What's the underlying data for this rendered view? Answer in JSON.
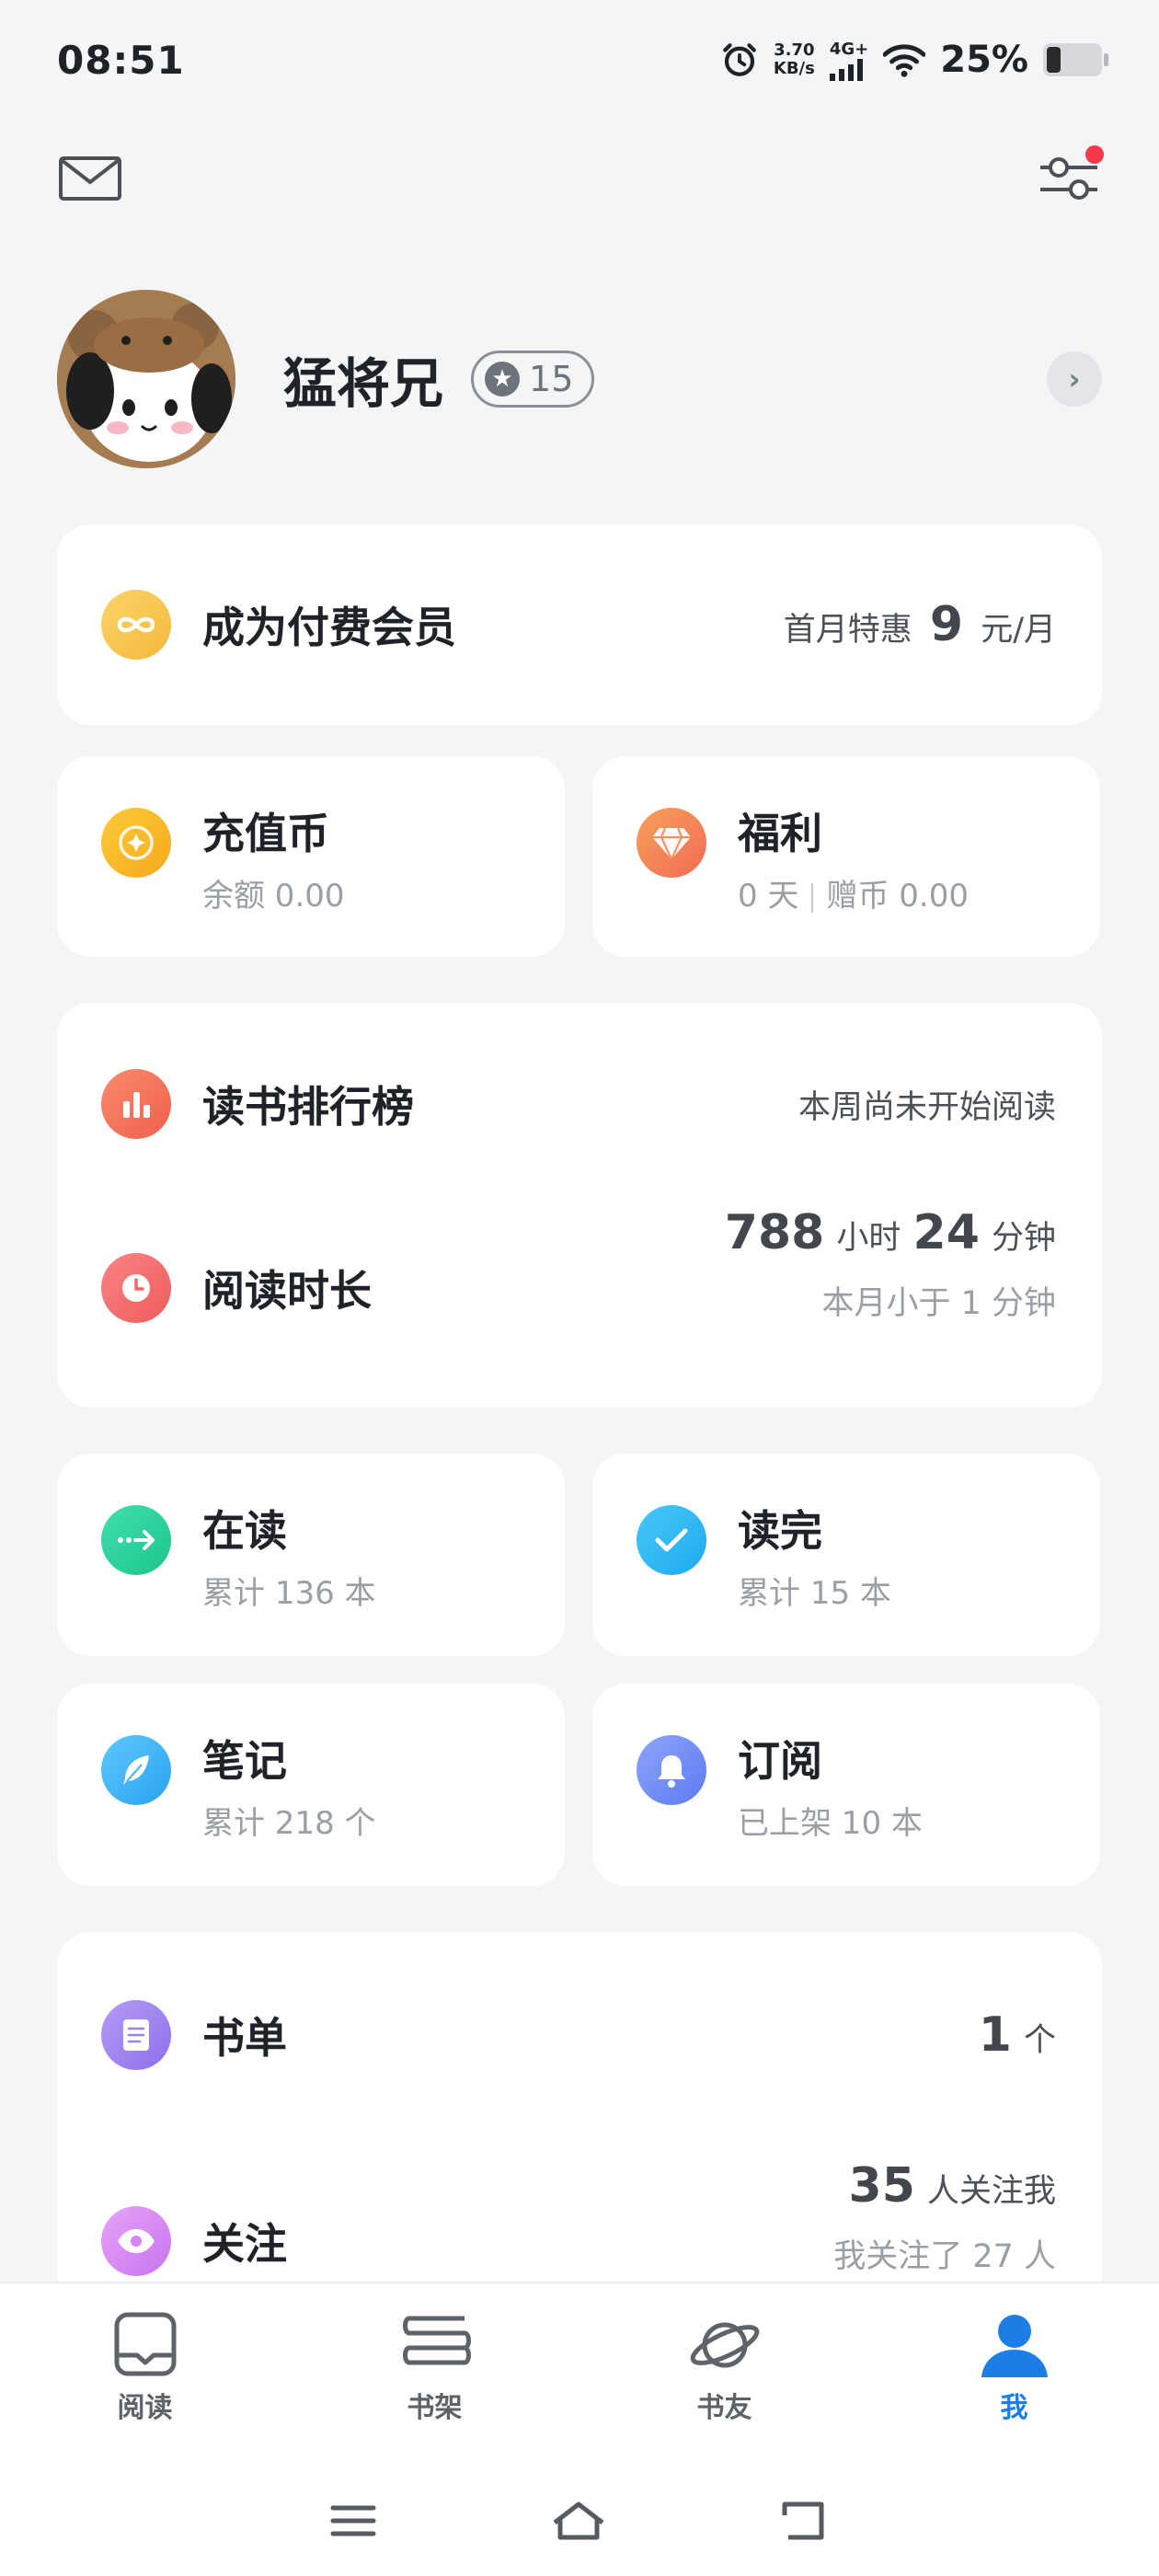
{
  "status_bar": {
    "time": "08:51",
    "speed_value": "3.70",
    "speed_unit": "KB/s",
    "network": "4G+",
    "battery": "25%"
  },
  "profile": {
    "name": "猛将兄",
    "level": "15"
  },
  "membership": {
    "title": "成为付费会员",
    "promo_prefix": "首月特惠",
    "promo_price": "9",
    "promo_unit": "元/月"
  },
  "coins": {
    "title": "充值币",
    "sub": "余额 0.00"
  },
  "welfare": {
    "title": "福利",
    "days": "0 天",
    "gift": "赠币 0.00"
  },
  "ranking": {
    "title": "读书排行榜",
    "status": "本周尚未开始阅读"
  },
  "reading_time": {
    "title": "阅读时长",
    "hours": "788",
    "hours_unit": "小时",
    "minutes": "24",
    "minutes_unit": "分钟",
    "month": "本月小于 1 分钟"
  },
  "reading": {
    "title": "在读",
    "sub": "累计 136 本"
  },
  "finished": {
    "title": "读完",
    "sub": "累计 15 本"
  },
  "notes": {
    "title": "笔记",
    "sub": "累计 218 个"
  },
  "subscribe": {
    "title": "订阅",
    "sub": "已上架 10 本"
  },
  "booklist": {
    "title": "书单",
    "count": "1",
    "unit": "个"
  },
  "follow": {
    "title": "关注",
    "followers": "35",
    "followers_label": "人关注我",
    "following": "我关注了 27 人"
  },
  "nav": {
    "read": "阅读",
    "shelf": "书架",
    "friends": "书友",
    "me": "我"
  },
  "colors": {
    "accent": "#1e7ee8",
    "membership": "#f5c451",
    "coins": "#f5b31c",
    "welfare": "#f47c5c",
    "ranking": "#f46f5e",
    "reading_time": "#f06c6c",
    "reading": "#2bd49b",
    "finished": "#2ab6f3",
    "notes": "#3fb6f6",
    "subscribe": "#6f8cf6",
    "booklist": "#a58af0",
    "follow": "#d48af0"
  }
}
